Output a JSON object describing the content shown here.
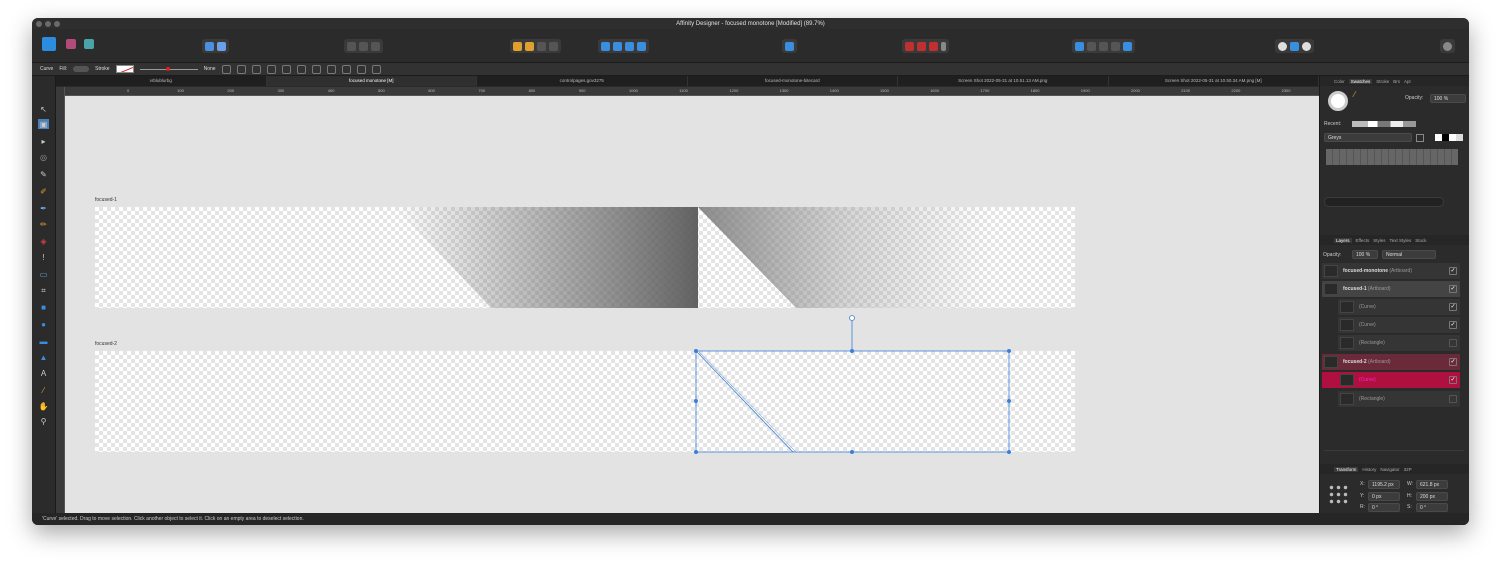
{
  "window": {
    "title": "Affinity Designer - focused monotone [Modified] (89.7%)"
  },
  "context_toolbar": {
    "tool": "Curve",
    "fill_label": "Fill:",
    "stroke_label": "Stroke",
    "stroke_value": "None"
  },
  "tabs": [
    {
      "label": "vrblublurbg"
    },
    {
      "label": "focused monotone [M]"
    },
    {
      "label": "controlpages.gov3275"
    },
    {
      "label": "focused-monotone-bitecard"
    },
    {
      "label": "Screen Shot 2022-05-31 at 10.51.13 AM.png"
    },
    {
      "label": "Screen Shot 2022-05-31 at 10.50.34 AM.png [M]"
    }
  ],
  "ruler": {
    "h_ticks": [
      "0",
      "100",
      "200",
      "300",
      "400",
      "500",
      "600",
      "700",
      "800",
      "900",
      "1000",
      "1100",
      "1200",
      "1300",
      "1400",
      "1500",
      "1600",
      "1700",
      "1800",
      "1900",
      "2000",
      "2100",
      "2200",
      "2300",
      "2400"
    ]
  },
  "canvas": {
    "artboard1": {
      "label": "focused-1"
    },
    "artboard2": {
      "label": "focused-2"
    }
  },
  "status_bar": {
    "text": "'Curve' selected. Drag to move selection. Click another object to select it. Click on an empty area to deselect selection."
  },
  "colors": {
    "accent": "#3b7fd6",
    "selected_layer": "#b0103f",
    "artboard_highlight": "#6b2a3a"
  },
  "right_panel": {
    "top_tabs": [
      "Color",
      "Swatches",
      "Stroke",
      "Brs",
      "Apr"
    ],
    "opacity_label": "Opacity:",
    "opacity_value": "100 %",
    "recent_label": "Recent:",
    "palette": "Greys",
    "layers_tabs": [
      "Layers",
      "Effects",
      "Styles",
      "Text Styles",
      "Stock"
    ],
    "layers_opacity_label": "Opacity:",
    "layers_opacity": "100 %",
    "blend_mode": "Normal",
    "layers": [
      {
        "name": "focused-monotone",
        "type": "(Artboard)"
      },
      {
        "name": "focused-1",
        "type": "(Artboard)"
      },
      {
        "name": "",
        "type": "(Curve)"
      },
      {
        "name": "",
        "type": "(Curve)"
      },
      {
        "name": "",
        "type": "(Rectangle)"
      },
      {
        "name": "focused-2",
        "type": "(Artboard)"
      },
      {
        "name": "",
        "type": "(Curve)"
      },
      {
        "name": "",
        "type": "(Rectangle)"
      }
    ],
    "bottom_tabs": [
      "Transform",
      "History",
      "Navigator",
      "32P"
    ],
    "transform": {
      "x": "1195.2 px",
      "y": "0 px",
      "w": "621.8 px",
      "h": "200 px",
      "r": "0 °",
      "s": "0 °"
    }
  }
}
